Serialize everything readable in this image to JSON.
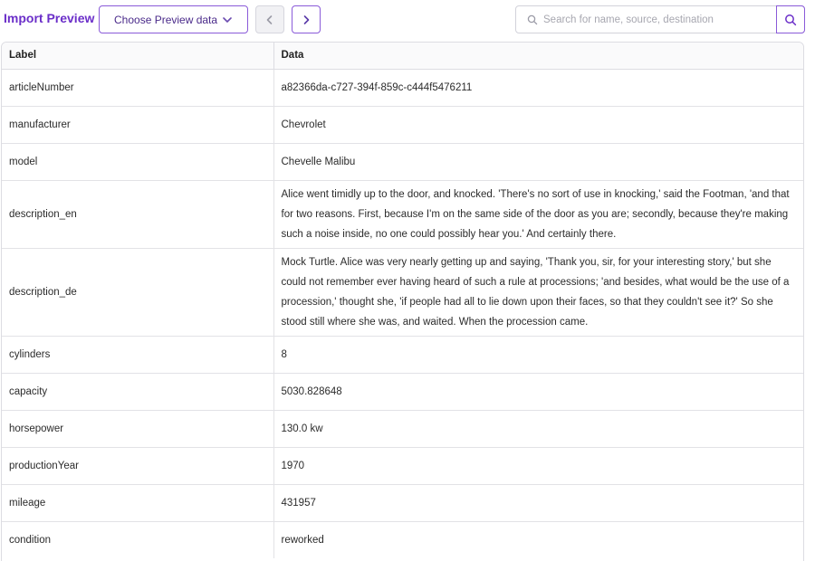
{
  "header": {
    "title": "Import Preview",
    "select_label": "Choose Preview data",
    "search_placeholder": "Search for name, source, destination"
  },
  "icons": {
    "chevron": "chevron-down-icon",
    "prev": "chevron-left-icon",
    "next": "chevron-right-icon",
    "search": "search-icon"
  },
  "colors": {
    "accent": "#6b2fc9",
    "border_accent": "#8a5ad9"
  },
  "table": {
    "columns": [
      "Label",
      "Data"
    ],
    "rows": [
      {
        "label": "articleNumber",
        "value": "a82366da-c727-394f-859c-c444f5476211"
      },
      {
        "label": "manufacturer",
        "value": "Chevrolet"
      },
      {
        "label": "model",
        "value": "Chevelle Malibu"
      },
      {
        "label": "description_en",
        "value": "Alice went timidly up to the door, and knocked. 'There's no sort of use in knocking,' said the Footman, 'and that for two reasons. First, because I'm on the same side of the door as you are; secondly, because they're making such a noise inside, no one could possibly hear you.' And certainly there."
      },
      {
        "label": "description_de",
        "value": "Mock Turtle. Alice was very nearly getting up and saying, 'Thank you, sir, for your interesting story,' but she could not remember ever having heard of such a rule at processions; 'and besides, what would be the use of a procession,' thought she, 'if people had all to lie down upon their faces, so that they couldn't see it?' So she stood still where she was, and waited. When the procession came."
      },
      {
        "label": "cylinders",
        "value": "8"
      },
      {
        "label": "capacity",
        "value": "5030.828648"
      },
      {
        "label": "horsepower",
        "value": "130.0 kw"
      },
      {
        "label": "productionYear",
        "value": "1970"
      },
      {
        "label": "mileage",
        "value": "431957"
      },
      {
        "label": "condition",
        "value": "reworked"
      }
    ]
  }
}
